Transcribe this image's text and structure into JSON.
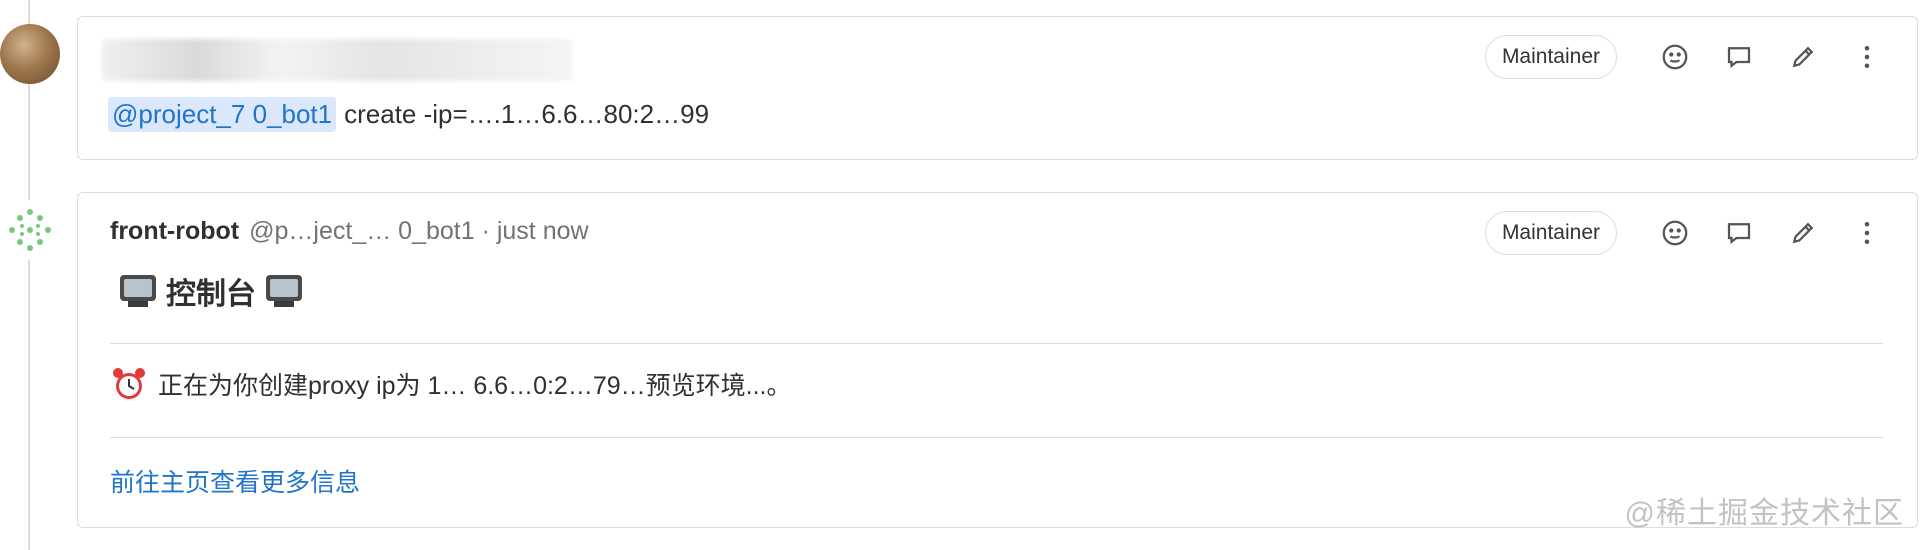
{
  "comments": [
    {
      "author_obscured": true,
      "mention": "@project_7 0_bot1",
      "command": "create -ip=….1…6.6…80:2…99",
      "role_badge": "Maintainer"
    },
    {
      "author": "front-robot",
      "handle": "@p…ject_… 0_bot1 · just now",
      "title": "控制台",
      "title_icon": "television-icon",
      "status_icon": "alarm-clock-icon",
      "status_text": "正在为你创建proxy ip为 1… 6.6…0:2…79…预览环境...。",
      "link_text": "前往主页查看更多信息",
      "role_badge": "Maintainer"
    }
  ],
  "actions": [
    "emoji-icon",
    "comment-icon",
    "edit-icon",
    "more-icon"
  ],
  "watermark": "@稀土掘金技术社区"
}
